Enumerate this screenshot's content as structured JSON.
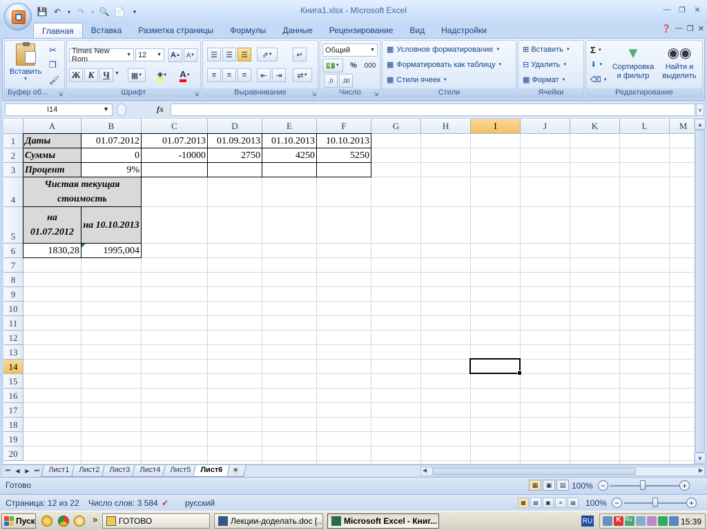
{
  "window": {
    "title": "Книга1.xlsx - Microsoft Excel"
  },
  "ribbon_tabs": [
    {
      "label": "Главная",
      "active": true
    },
    {
      "label": "Вставка"
    },
    {
      "label": "Разметка страницы"
    },
    {
      "label": "Формулы"
    },
    {
      "label": "Данные"
    },
    {
      "label": "Рецензирование"
    },
    {
      "label": "Вид"
    },
    {
      "label": "Надстройки"
    }
  ],
  "ribbon": {
    "clipboard": {
      "label": "Буфер об...",
      "paste": "Вставить"
    },
    "font": {
      "label": "Шрифт",
      "name": "Times New Rom",
      "size": "12",
      "bold": "Ж",
      "italic": "К",
      "underline": "Ч",
      "grow": "A",
      "shrink": "A",
      "color_letter": "A"
    },
    "alignment": {
      "label": "Выравнивание"
    },
    "number": {
      "label": "Число",
      "format": "Общий",
      "percent": "%",
      "thousands": "000",
      "inc_dec": ",0",
      "dec_dec": ",00"
    },
    "styles": {
      "label": "Стили",
      "conditional": "Условное форматирование",
      "as_table": "Форматировать как таблицу",
      "cell_styles": "Стили ячеек"
    },
    "cells": {
      "label": "Ячейки",
      "insert": "Вставить",
      "delete": "Удалить",
      "format": "Формат"
    },
    "editing": {
      "label": "Редактирование",
      "sum": "Σ",
      "sort": "Сортировка и фильтр",
      "find": "Найти и выделить"
    }
  },
  "formula_bar": {
    "name_box": "I14",
    "fx": "fx",
    "value": ""
  },
  "columns": [
    "A",
    "B",
    "C",
    "D",
    "E",
    "F",
    "G",
    "H",
    "I",
    "J",
    "K",
    "L",
    "M"
  ],
  "rows": [
    "1",
    "2",
    "3",
    "4",
    "5",
    "6",
    "7",
    "8",
    "9",
    "10",
    "11",
    "12",
    "13",
    "14",
    "15",
    "16",
    "17",
    "18",
    "19",
    "20"
  ],
  "selected": {
    "col": "I",
    "row": "14"
  },
  "cells": {
    "A1": "Даты",
    "B1": "01.07.2012",
    "C1": "01.07.2013",
    "D1": "01.09.2013",
    "E1": "01.10.2013",
    "F1": "10.10.2013",
    "A2": "Суммы",
    "B2": "0",
    "C2": "-10000",
    "D2": "2750",
    "E2": "4250",
    "F2": "5250",
    "A3": "Процент",
    "B3": "9%",
    "A4": "Чистая текущая стоимость",
    "A5": "на 01.07.2012",
    "B5": "на 10.10.2013",
    "A6": "1830,28",
    "B6": "1995,004"
  },
  "sheets": [
    {
      "label": "Лист1"
    },
    {
      "label": "Лист2"
    },
    {
      "label": "Лист3"
    },
    {
      "label": "Лист4"
    },
    {
      "label": "Лист5"
    },
    {
      "label": "Лист6",
      "active": true
    }
  ],
  "status": {
    "ready": "Готово",
    "zoom": "100%",
    "minus": "−",
    "plus": "+"
  },
  "word_status": {
    "page": "Страница: 12 из 22",
    "words": "Число слов: 3 584",
    "lang": "русский",
    "zoom": "100%",
    "minus": "−",
    "plus": "+"
  },
  "taskbar": {
    "start": "Пуск",
    "quick_more": "»",
    "items": [
      {
        "label": "ГОТОВО"
      },
      {
        "label": "Лекции-доделать.doc [..."
      },
      {
        "label": "Microsoft Excel - Книг...",
        "active": true
      }
    ],
    "lang": "RU",
    "clock": "15:39"
  },
  "colors": {
    "accent": "#15428b",
    "selected_header": "#f1c15f",
    "shade": "#d9d9d9"
  }
}
